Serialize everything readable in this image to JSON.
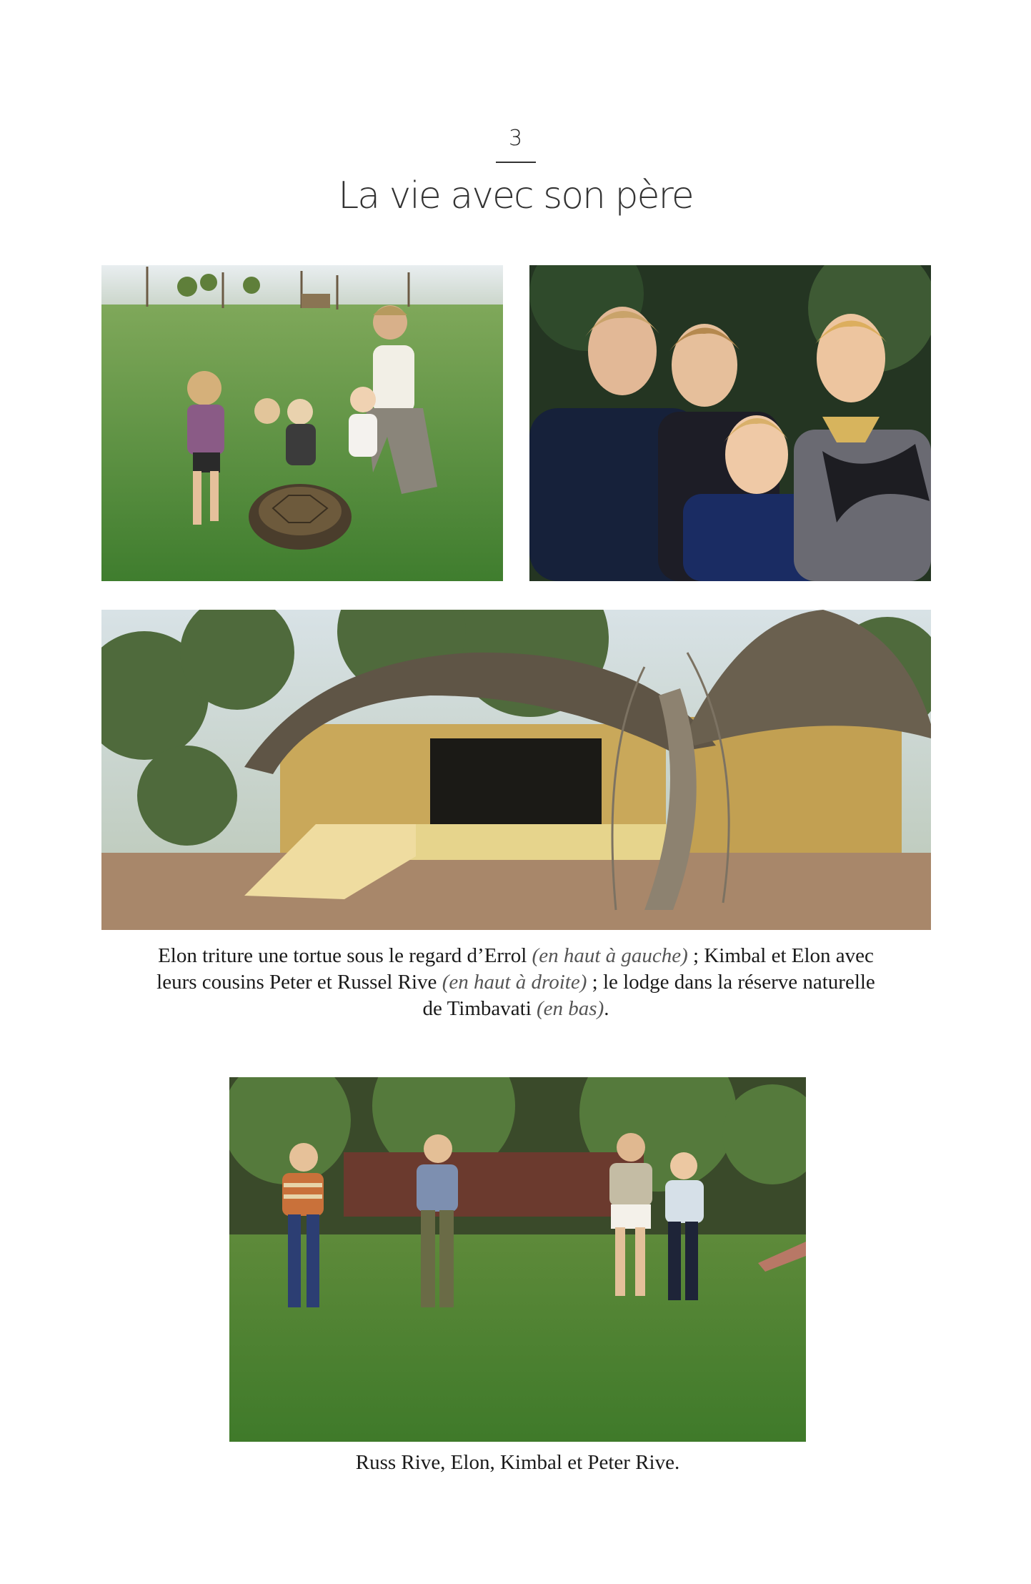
{
  "chapter": {
    "number": "3",
    "title": "La vie avec son père"
  },
  "photos": {
    "tortoise": "photo-tortoise",
    "cousins": "photo-cousins",
    "lodge": "photo-lodge",
    "boys": "photo-boys"
  },
  "caption_top": {
    "part1": "Elon triture une tortue sous le regard d’Errol ",
    "note1": "(en haut à gauche)",
    "part2": " ; Kimbal et Elon avec leurs cousins Peter et Russel Rive ",
    "note2": "(en haut à droite)",
    "part3": " ; le lodge dans la réserve naturelle de Timbavati ",
    "note3": "(en bas)",
    "part4": "."
  },
  "caption_bottom": "Russ Rive, Elon, Kimbal et Peter Rive."
}
